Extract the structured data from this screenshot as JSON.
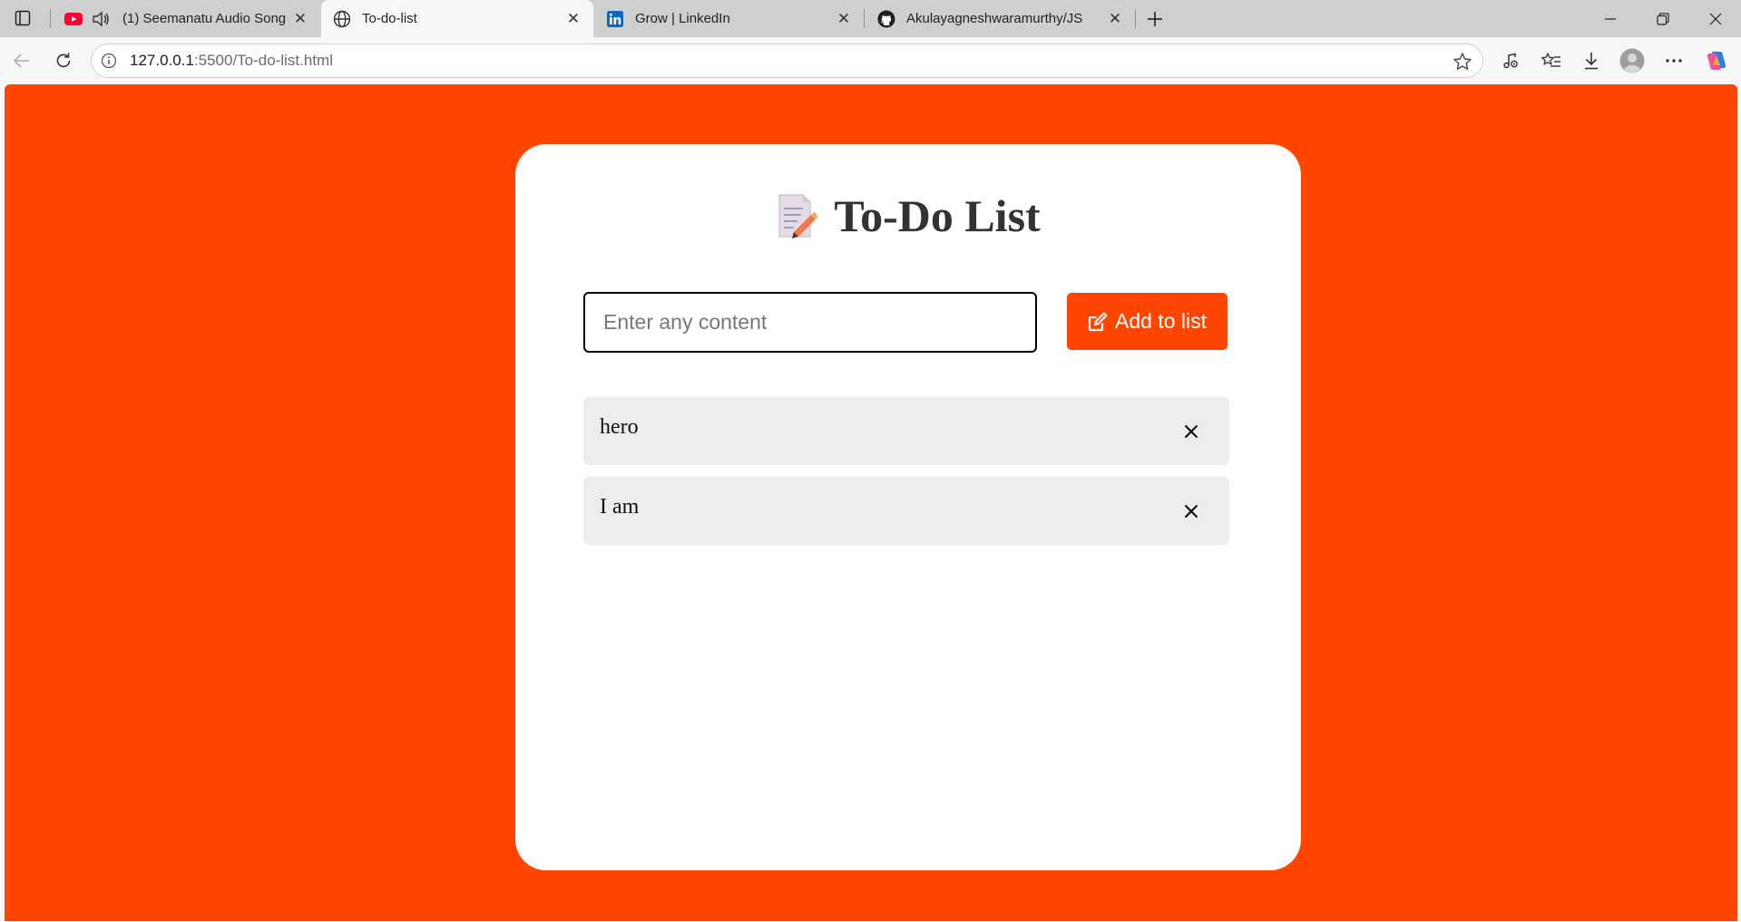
{
  "browser": {
    "tabs": [
      {
        "title": "(1) Seemanatu Audio Song |",
        "icon": "youtube-icon",
        "audio": true,
        "active": false
      },
      {
        "title": "To-do-list",
        "icon": "globe-icon",
        "active": true
      },
      {
        "title": "Grow | LinkedIn",
        "icon": "linkedin-icon",
        "active": false
      },
      {
        "title": "Akulayagneshwaramurthy/JS",
        "icon": "github-icon",
        "active": false
      }
    ],
    "url_host": "127.0.0.1",
    "url_rest": ":5500/To-do-list.html"
  },
  "app": {
    "title": "To-Do List",
    "title_icon": "memo-icon",
    "input_placeholder": "Enter any content",
    "input_value": "",
    "add_button_label": "Add to list",
    "items": [
      {
        "text": "hero"
      },
      {
        "text": "I am"
      }
    ]
  },
  "colors": {
    "accent": "#ff4500",
    "card": "#ffffff",
    "item_bg": "#ededed",
    "heading": "#333333"
  }
}
